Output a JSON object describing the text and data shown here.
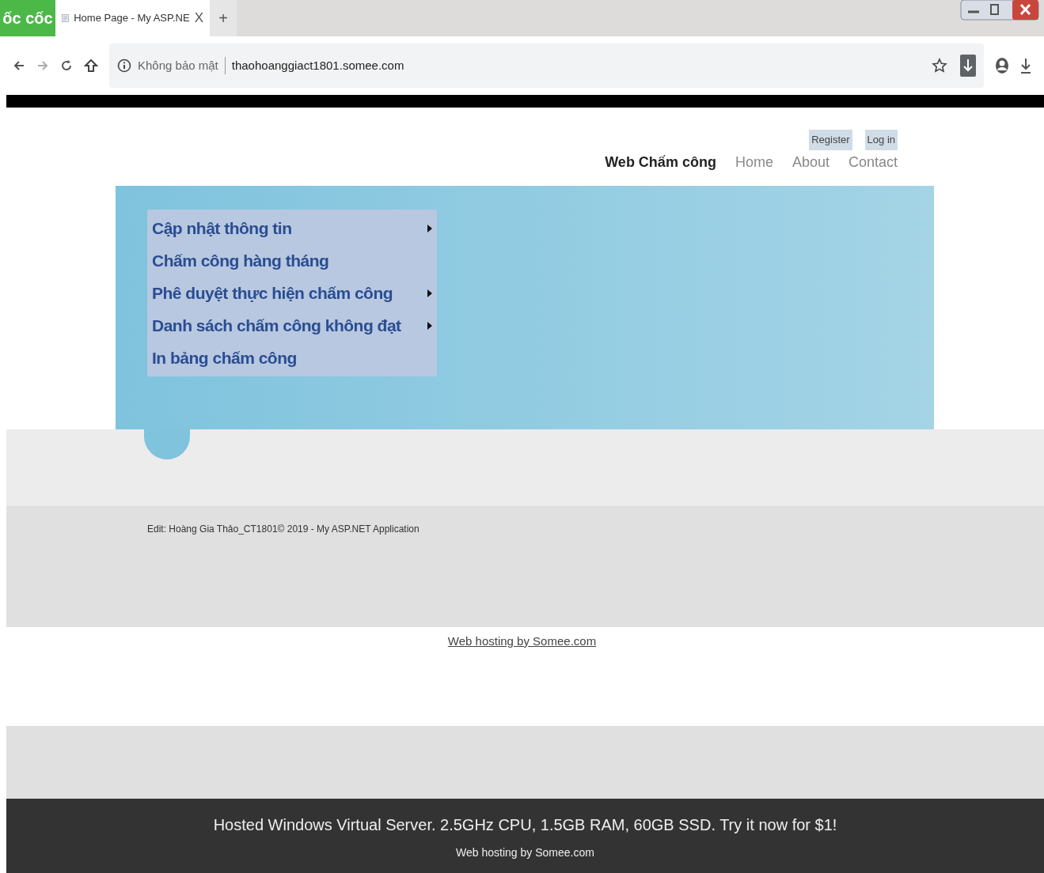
{
  "browser": {
    "logo": "ốc cốc",
    "tab": {
      "title": "Home Page - My ASP.NE",
      "close": "X"
    },
    "new_tab": "+",
    "security_label": "Không bảo mật",
    "url": "thaohoanggiact1801.somee.com"
  },
  "site": {
    "brand": "Web Chấm công",
    "nav_links": [
      "Home",
      "About",
      "Contact"
    ],
    "account_links": [
      "Register",
      "Log in"
    ],
    "menu": [
      {
        "label": "Cập nhật thông tin",
        "has_submenu": true
      },
      {
        "label": "Chấm công hàng tháng",
        "has_submenu": false
      },
      {
        "label": "Phê duyệt thực hiện chấm công",
        "has_submenu": true
      },
      {
        "label": "Danh sách chấm công không đạt",
        "has_submenu": true
      },
      {
        "label": "In bảng chấm công",
        "has_submenu": false
      }
    ],
    "footer_text": "Edit: Hoàng Gia Thảo_CT1801© 2019 - My ASP.NET Application",
    "hosting_link": "Web hosting by Somee.com"
  },
  "ad_banner": {
    "text": "Hosted Windows Virtual Server. 2.5GHz CPU, 1.5GB RAM, 60GB SSD. Try it now for $1!",
    "link": "Web hosting by Somee.com"
  }
}
